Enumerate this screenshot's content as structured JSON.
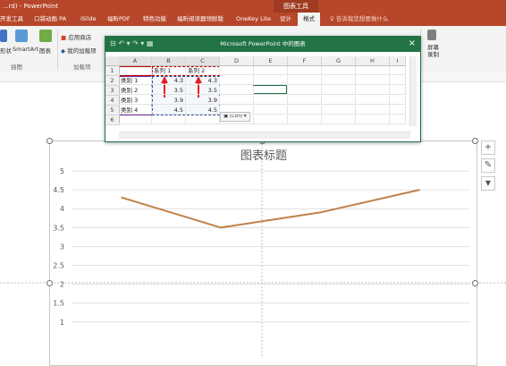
{
  "app": {
    "title": "...rd) - PowerPoint",
    "context_tab_group": "图表工具"
  },
  "tabs": [
    {
      "label": "开发工具"
    },
    {
      "label": "口袋动画 PA"
    },
    {
      "label": "iSlide"
    },
    {
      "label": "福昕PDF"
    },
    {
      "label": "特色功能"
    },
    {
      "label": "福昕阅读器领鲜版"
    },
    {
      "label": "OneKey Lite"
    },
    {
      "label": "设计"
    },
    {
      "label": "格式"
    }
  ],
  "tell_me": "告诉我您想要做什么",
  "ribbon": {
    "shape_label": "形状",
    "smartart_label": "SmartArt",
    "chart_label": "图表",
    "app_store_label": "应用商店",
    "my_addins_label": "我的加载项",
    "screen_record_label": "屏幕录制",
    "group_illustrations": "插图",
    "group_addins": "加载项"
  },
  "sheet": {
    "title": "Microsoft PowerPoint 中的图表",
    "quick_access": "⊟  ↶ ▾ ↷ ▾  ▦",
    "close_label": "×",
    "columns": [
      "A",
      "B",
      "C",
      "D",
      "E",
      "F",
      "G",
      "H",
      "I"
    ],
    "rows": [
      "1",
      "2",
      "3",
      "4",
      "5",
      "6"
    ],
    "headers": [
      "",
      "系列 1",
      "系列 2"
    ],
    "data": [
      [
        "类别 1",
        "4.3",
        "4.3"
      ],
      [
        "类别 2",
        "3.5",
        "3.5"
      ],
      [
        "类别 3",
        "3.9",
        "3.9"
      ],
      [
        "类别 4",
        "4.5",
        "4.5"
      ]
    ],
    "paste_options": "(Ctrl)"
  },
  "chart": {
    "title": "图表标题",
    "side_buttons": [
      "+",
      "✎",
      "▼"
    ],
    "line_color": "#c0814a"
  },
  "chart_data": {
    "type": "line",
    "title": "图表标题",
    "categories": [
      "类别 1",
      "类别 2",
      "类别 3",
      "类别 4"
    ],
    "series": [
      {
        "values": [
          4.3,
          3.5,
          3.9,
          4.5
        ]
      }
    ],
    "ylim": [
      0,
      5
    ],
    "yticks": [
      "5",
      "4.5",
      "4",
      "3.5",
      "3",
      "2.5",
      "2",
      "1.5",
      "1"
    ],
    "grid": true
  },
  "colors": {
    "accent": "#b7472a",
    "sheet_accent": "#217346",
    "arrow_red": "#e02020"
  }
}
